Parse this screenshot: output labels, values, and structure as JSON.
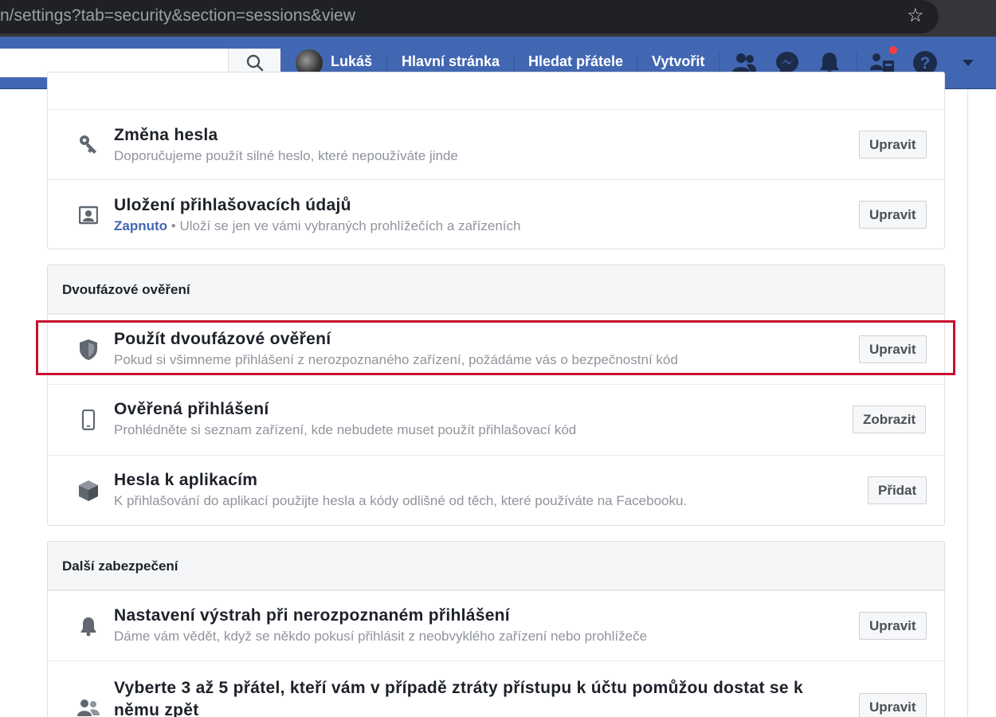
{
  "browser": {
    "url": "n/settings?tab=security&section=sessions&view"
  },
  "navbar": {
    "search_placeholder": "",
    "user_name": "Lukáš",
    "links": [
      "Hlavní stránka",
      "Hledat přátele",
      "Vytvořit"
    ],
    "icons": [
      "friend-requests-icon",
      "messenger-icon",
      "notifications-icon",
      "groups-icon",
      "help-icon",
      "dropdown-arrow-icon"
    ]
  },
  "login_section": {
    "rows": [
      {
        "icon": "key-icon",
        "title": "Změna hesla",
        "subtitle": "Doporučujeme použít silné heslo, které nepoužíváte jinde",
        "button": "Upravit"
      },
      {
        "icon": "profile-card-icon",
        "title": "Uložení přihlašovacích údajů",
        "status": "Zapnuto",
        "subtitle": " • Uloží se jen ve vámi vybraných prohlížečích a zařízeních",
        "button": "Upravit"
      }
    ]
  },
  "two_factor": {
    "header": "Dvoufázové ověření",
    "rows": [
      {
        "icon": "shield-icon",
        "title": "Použít dvoufázové ověření",
        "subtitle": "Pokud si všimneme přihlášení z nerozpoznaného zařízení, požádáme vás o bezpečnostní kód",
        "button": "Upravit"
      },
      {
        "icon": "phone-icon",
        "title": "Ověřená přihlášení",
        "subtitle": "Prohlédněte si seznam zařízení, kde nebudete muset použít přihlašovací kód",
        "button": "Zobrazit"
      },
      {
        "icon": "cube-icon",
        "title": "Hesla k aplikacím",
        "subtitle": "K přihlašování do aplikací použijte hesla a kódy odlišné od těch, které používáte na Facebooku.",
        "button": "Přidat"
      }
    ]
  },
  "extra_security": {
    "header": "Další zabezpečení",
    "rows": [
      {
        "icon": "bell-icon",
        "title": "Nastavení výstrah při nerozpoznaném přihlášení",
        "subtitle": "Dáme vám vědět, když se někdo pokusí přihlásit z neobvyklého zařízení nebo prohlížeče",
        "button": "Upravit"
      },
      {
        "icon": "friends-icon",
        "title": "Vyberte 3 až 5 přátel, kteří vám v případě ztráty přístupu k účtu pomůžou dostat se k němu zpět",
        "button": "Upravit"
      }
    ]
  },
  "colors": {
    "brand_blue": "#4267b2",
    "highlight_red": "#c8102e",
    "notification_dot": "#fa3e3e"
  }
}
